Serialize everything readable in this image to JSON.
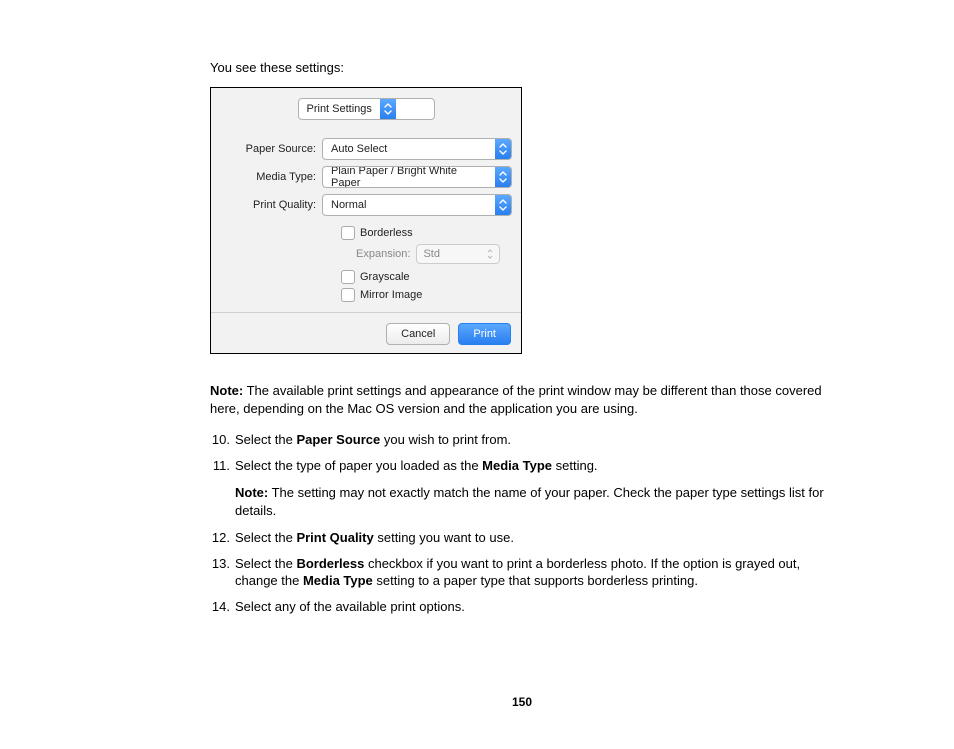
{
  "intro": "You see these settings:",
  "dialog": {
    "section_dropdown": "Print Settings",
    "fields": {
      "paper_source": {
        "label": "Paper Source:",
        "value": "Auto Select"
      },
      "media_type": {
        "label": "Media Type:",
        "value": "Plain Paper / Bright White Paper"
      },
      "print_quality": {
        "label": "Print Quality:",
        "value": "Normal"
      }
    },
    "checkboxes": {
      "borderless": "Borderless",
      "grayscale": "Grayscale",
      "mirror": "Mirror Image"
    },
    "expansion": {
      "label": "Expansion:",
      "value": "Std"
    },
    "buttons": {
      "cancel": "Cancel",
      "print": "Print"
    }
  },
  "note1_prefix": "Note:",
  "note1_body": " The available print settings and appearance of the print window may be different than those covered here, depending on the Mac OS version and the application you are using.",
  "steps": {
    "s10_a": "Select the ",
    "s10_b": "Paper Source",
    "s10_c": " you wish to print from.",
    "s11_a": "Select the type of paper you loaded as the ",
    "s11_b": "Media Type",
    "s11_c": " setting.",
    "s11_note_prefix": "Note:",
    "s11_note_body": " The setting may not exactly match the name of your paper. Check the paper type settings list for details.",
    "s12_a": "Select the ",
    "s12_b": "Print Quality",
    "s12_c": " setting you want to use.",
    "s13_a": "Select the ",
    "s13_b": "Borderless",
    "s13_c": " checkbox if you want to print a borderless photo. If the option is grayed out, change the ",
    "s13_d": "Media Type",
    "s13_e": " setting to a paper type that supports borderless printing.",
    "s14": "Select any of the available print options."
  },
  "page_number": "150"
}
